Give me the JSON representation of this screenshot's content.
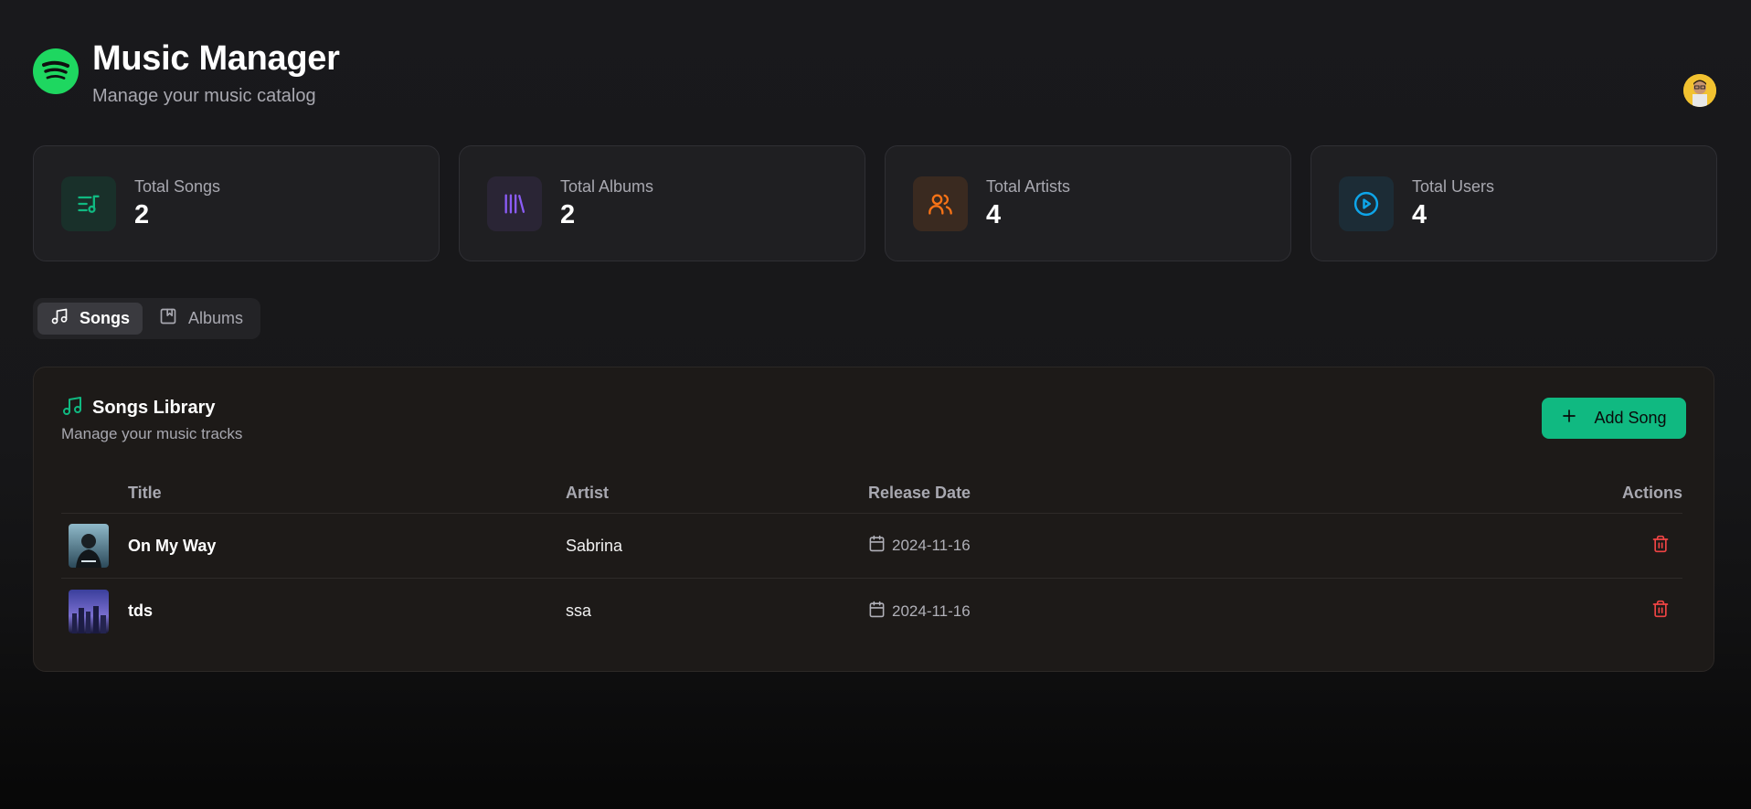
{
  "header": {
    "title": "Music Manager",
    "subtitle": "Manage your music catalog"
  },
  "colors": {
    "brand_green": "#1ed760",
    "accent_green": "#10b981",
    "purple": "#8b5cf6",
    "orange": "#f97316",
    "blue": "#0ea5e9",
    "danger": "#ef4444"
  },
  "stats": [
    {
      "label": "Total Songs",
      "value": "2",
      "icon": "playlist-music-icon"
    },
    {
      "label": "Total Albums",
      "value": "2",
      "icon": "library-icon"
    },
    {
      "label": "Total Artists",
      "value": "4",
      "icon": "users-icon"
    },
    {
      "label": "Total Users",
      "value": "4",
      "icon": "play-circle-icon"
    }
  ],
  "tabs": [
    {
      "label": "Songs",
      "active": true,
      "icon": "music-note-icon"
    },
    {
      "label": "Albums",
      "active": false,
      "icon": "album-icon"
    }
  ],
  "library": {
    "title": "Songs Library",
    "subtitle": "Manage your music tracks",
    "add_label": "Add Song",
    "columns": {
      "title": "Title",
      "artist": "Artist",
      "release_date": "Release Date",
      "actions": "Actions"
    },
    "songs": [
      {
        "title": "On My Way",
        "artist": "Sabrina",
        "release_date": "2024-11-16"
      },
      {
        "title": "tds",
        "artist": "ssa",
        "release_date": "2024-11-16"
      }
    ]
  }
}
